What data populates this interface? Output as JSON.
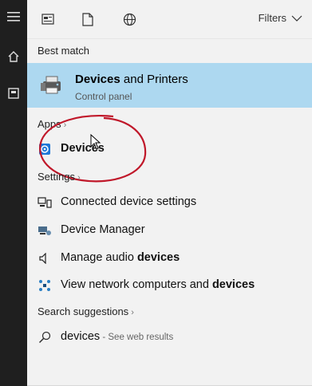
{
  "topbar": {
    "icons": [
      "document-icon",
      "page-icon",
      "globe-icon"
    ],
    "filters_label": "Filters"
  },
  "best_match": {
    "section_label": "Best match",
    "title_bold": "Devices",
    "title_rest": " and Printers",
    "subtitle": "Control panel"
  },
  "apps": {
    "section_label": "Apps",
    "items": [
      {
        "label_bold": "Devices"
      }
    ]
  },
  "settings": {
    "section_label": "Settings",
    "items": [
      {
        "label": "Connected device settings",
        "bold": ""
      },
      {
        "label": "Device Manager",
        "bold": ""
      },
      {
        "label": "Manage audio ",
        "bold": "devices"
      },
      {
        "label": "View network computers and ",
        "bold": "devices"
      }
    ]
  },
  "suggestions": {
    "section_label": "Search suggestions",
    "items": [
      {
        "query": "devices",
        "hint": " - See web results"
      }
    ]
  },
  "colors": {
    "highlight": "#add8f0",
    "annotation": "#c0182a",
    "app_icon": "#1e78d7"
  }
}
